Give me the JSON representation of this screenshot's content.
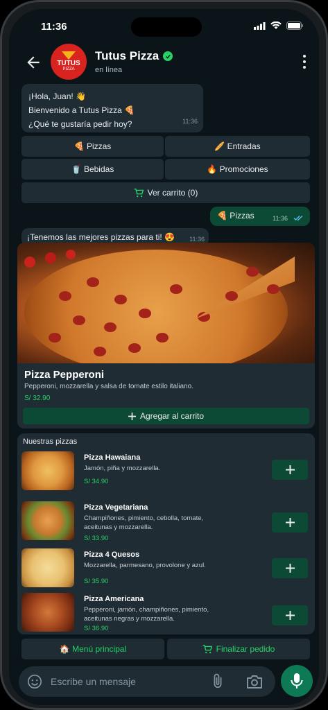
{
  "status": {
    "time": "11:36"
  },
  "header": {
    "name": "Tutus Pizza",
    "status": "en línea",
    "avatar_line1": "TUTUS",
    "avatar_line2": "PIZZA"
  },
  "welcome": {
    "line1": "¡Hola, Juan! 👋",
    "line2": "Bienvenido a Tutus Pizza 🍕",
    "line3": "¿Qué te gustaría pedir hoy?",
    "time": "11:36"
  },
  "quick": {
    "pizzas": "🍕 Pizzas",
    "entradas": "🥖 Entradas",
    "bebidas": "🥤 Bebidas",
    "promociones": "🔥 Promociones",
    "carrito": "Ver carrito (0)"
  },
  "outgoing": {
    "text": "🍕 Pizzas",
    "time": "11:36"
  },
  "reply": {
    "text": "¡Tenemos las mejores pizzas para ti! 😍",
    "time": "11:36"
  },
  "featured": {
    "name": "Pizza Pepperoni",
    "description": "Pepperoni, mozzarella y salsa de tomate estilo italiano.",
    "price": "S/ 32.90",
    "button": "Agregar al carrito"
  },
  "list": {
    "heading": "Nuestras pizzas",
    "items": [
      {
        "name": "Pizza Hawaiana",
        "desc": "Jamón, piña y mozzarella.",
        "price": "S/ 34.90"
      },
      {
        "name": "Pizza Vegetariana",
        "desc": "Champiñones, pimiento, cebolla, tomate, aceitunas y mozzarella.",
        "price": "S/ 33.90"
      },
      {
        "name": "Pizza 4 Quesos",
        "desc": "Mozzarella, parmesano, provolone y azul.",
        "price": "S/ 35.90"
      },
      {
        "name": "Pizza Americana",
        "desc": "Pepperoni, jamón, champiñones, pimiento, aceitunas negras y mozzarella.",
        "price": "S/ 36.90"
      }
    ]
  },
  "footer": {
    "menu": "🏠 Menú principal",
    "checkout": "Finalizar pedido"
  },
  "composer": {
    "placeholder": "Escribe un mensaje"
  },
  "colors": {
    "background": "#0b1418",
    "bubble_in": "#1f2c33",
    "bubble_out": "#0d4a36",
    "accent": "#25d366"
  },
  "icons": [
    "back-arrow-icon",
    "verified-icon",
    "more-vert-icon",
    "cart-icon",
    "plus-icon",
    "double-check-icon",
    "emoji-icon",
    "attach-icon",
    "camera-icon",
    "mic-icon"
  ]
}
